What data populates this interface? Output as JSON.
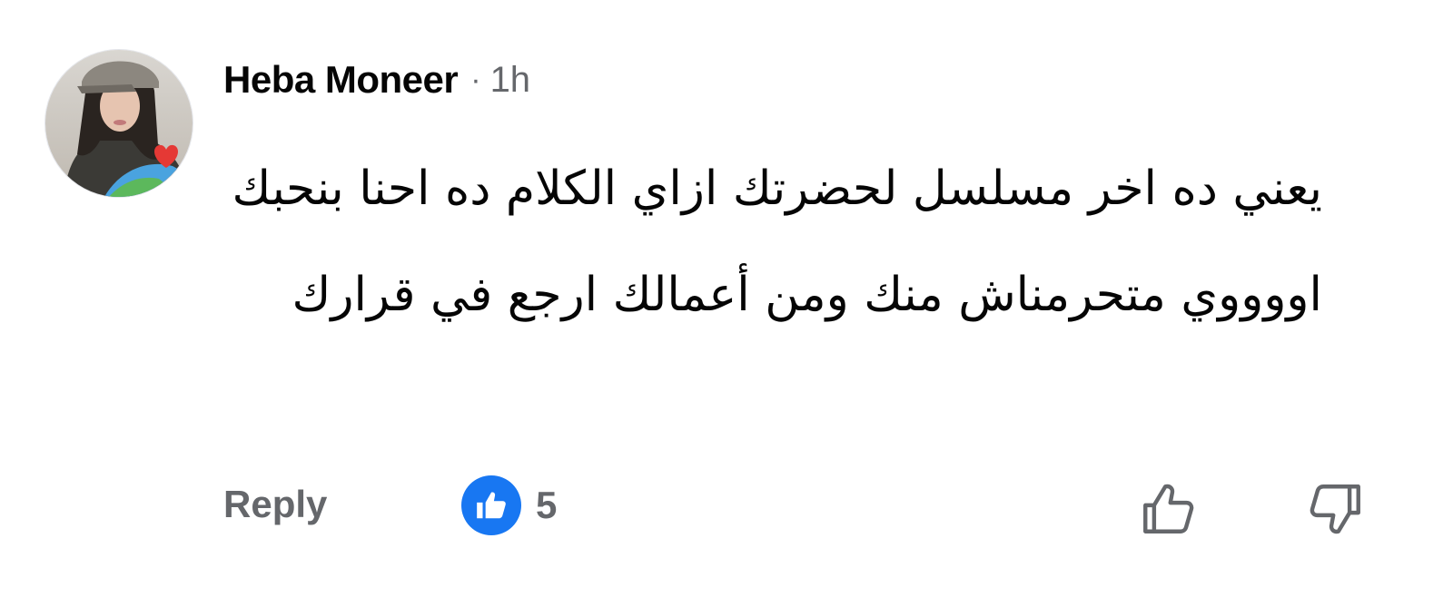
{
  "comment": {
    "author": "Heba Moneer",
    "separator": "·",
    "time": "1h",
    "text": "يعني ده اخر مسلسل لحضرتك ازاي الكلام ده احنا بنحبك اووووي متحرمناش منك ومن أعمالك ارجع في قرارك",
    "reply_label": "Reply",
    "reaction_count": "5",
    "reaction_type": "like-icon"
  },
  "colors": {
    "accent": "#1877f2",
    "secondary_text": "#65676b",
    "primary_text": "#050505"
  },
  "icons": {
    "reaction_badge": "like-icon",
    "upvote": "thumbs-up-outline-icon",
    "downvote": "thumbs-down-outline-icon"
  }
}
